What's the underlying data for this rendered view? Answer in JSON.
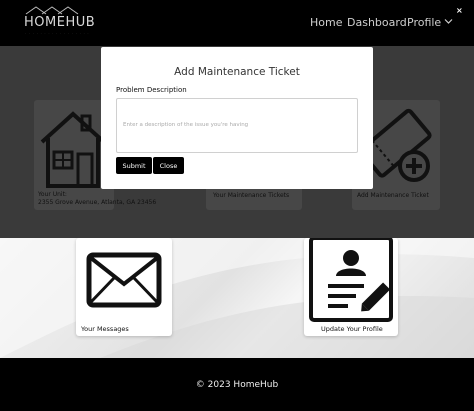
{
  "brand": {
    "name": "HOMEHUB",
    "tagline": "· · · · · · · · · · · · · · · · ·"
  },
  "nav": {
    "items": [
      {
        "label": "Home"
      },
      {
        "label": "Dashboard"
      },
      {
        "label": "Profile"
      }
    ]
  },
  "dashboard": {
    "unit_label": "Your Unit:",
    "unit_address": "2355 Grove Avenue, Atlanta, GA 23456",
    "tickets_label": "Your Maintenance Tickets",
    "add_ticket_label": "Add Maintenance Ticket",
    "messages_label": "Your Messages",
    "profile_label": "Update Your Profile"
  },
  "modal": {
    "title": "Add Maintenance Ticket",
    "field_label": "Problem Description",
    "placeholder": "Enter a description of the issue you're having",
    "submit_label": "Submit",
    "close_label": "Close",
    "close_x": "×"
  },
  "footer": {
    "text": "© 2023 HomeHub"
  },
  "colors": {
    "overlay": "#3a3a3a",
    "button": "#000000",
    "footer": "#000000"
  }
}
